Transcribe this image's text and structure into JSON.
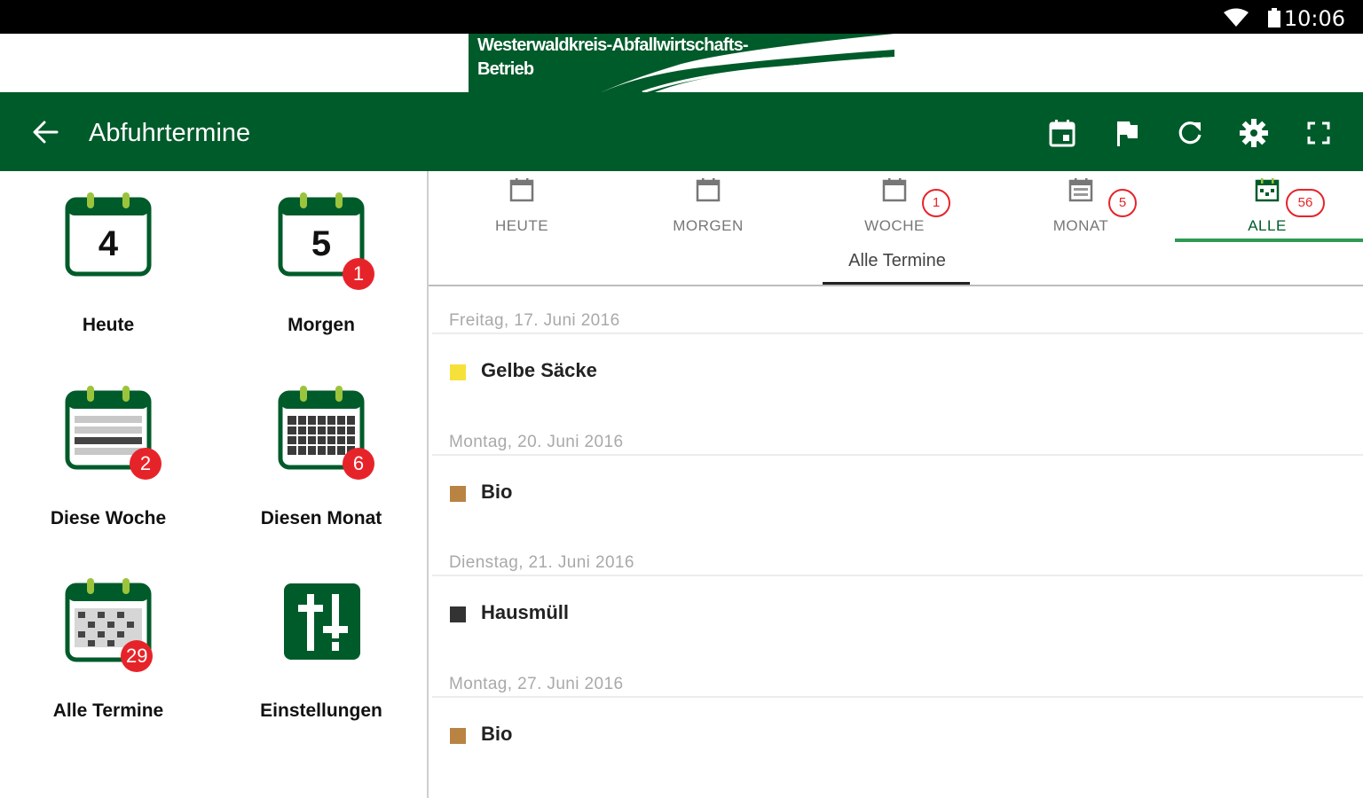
{
  "status_bar": {
    "time": "10:06",
    "icons": [
      "wifi-icon",
      "battery-icon"
    ]
  },
  "banner": {
    "line1": "Westerwaldkreis-Abfallwirtschafts-",
    "line2": "Betrieb"
  },
  "app_bar": {
    "title": "Abfuhrtermine",
    "actions": [
      "calendar-icon",
      "flag-icon",
      "refresh-icon",
      "settings-icon",
      "fullscreen-icon"
    ]
  },
  "tiles": [
    {
      "label": "Heute",
      "day": "4",
      "badge": ""
    },
    {
      "label": "Morgen",
      "day": "5",
      "badge": "1"
    },
    {
      "label": "Diese Woche",
      "badge": "2"
    },
    {
      "label": "Diesen Monat",
      "badge": "6"
    },
    {
      "label": "Alle Termine",
      "badge": "29"
    },
    {
      "label": "Einstellungen"
    }
  ],
  "tabs": [
    {
      "label": "HEUTE",
      "count": ""
    },
    {
      "label": "MORGEN",
      "count": ""
    },
    {
      "label": "WOCHE",
      "count": "1"
    },
    {
      "label": "MONAT",
      "count": "5"
    },
    {
      "label": "ALLE",
      "count": "56"
    }
  ],
  "active_tab": "ALLE",
  "subtab": "Alle Termine",
  "entries": [
    {
      "date": "Freitag, 17. Juni 2016",
      "type": "Gelbe Säcke",
      "color": "#f6e13a"
    },
    {
      "date": "Montag, 20. Juni 2016",
      "type": "Bio",
      "color": "#b98343"
    },
    {
      "date": "Dienstag, 21. Juni 2016",
      "type": "Hausmüll",
      "color": "#333333"
    },
    {
      "date": "Montag, 27. Juni 2016",
      "type": "Bio",
      "color": "#b98343"
    }
  ],
  "colors": {
    "primary": "#005b2a",
    "accent": "#2f9a54",
    "badge": "#e7232a"
  }
}
